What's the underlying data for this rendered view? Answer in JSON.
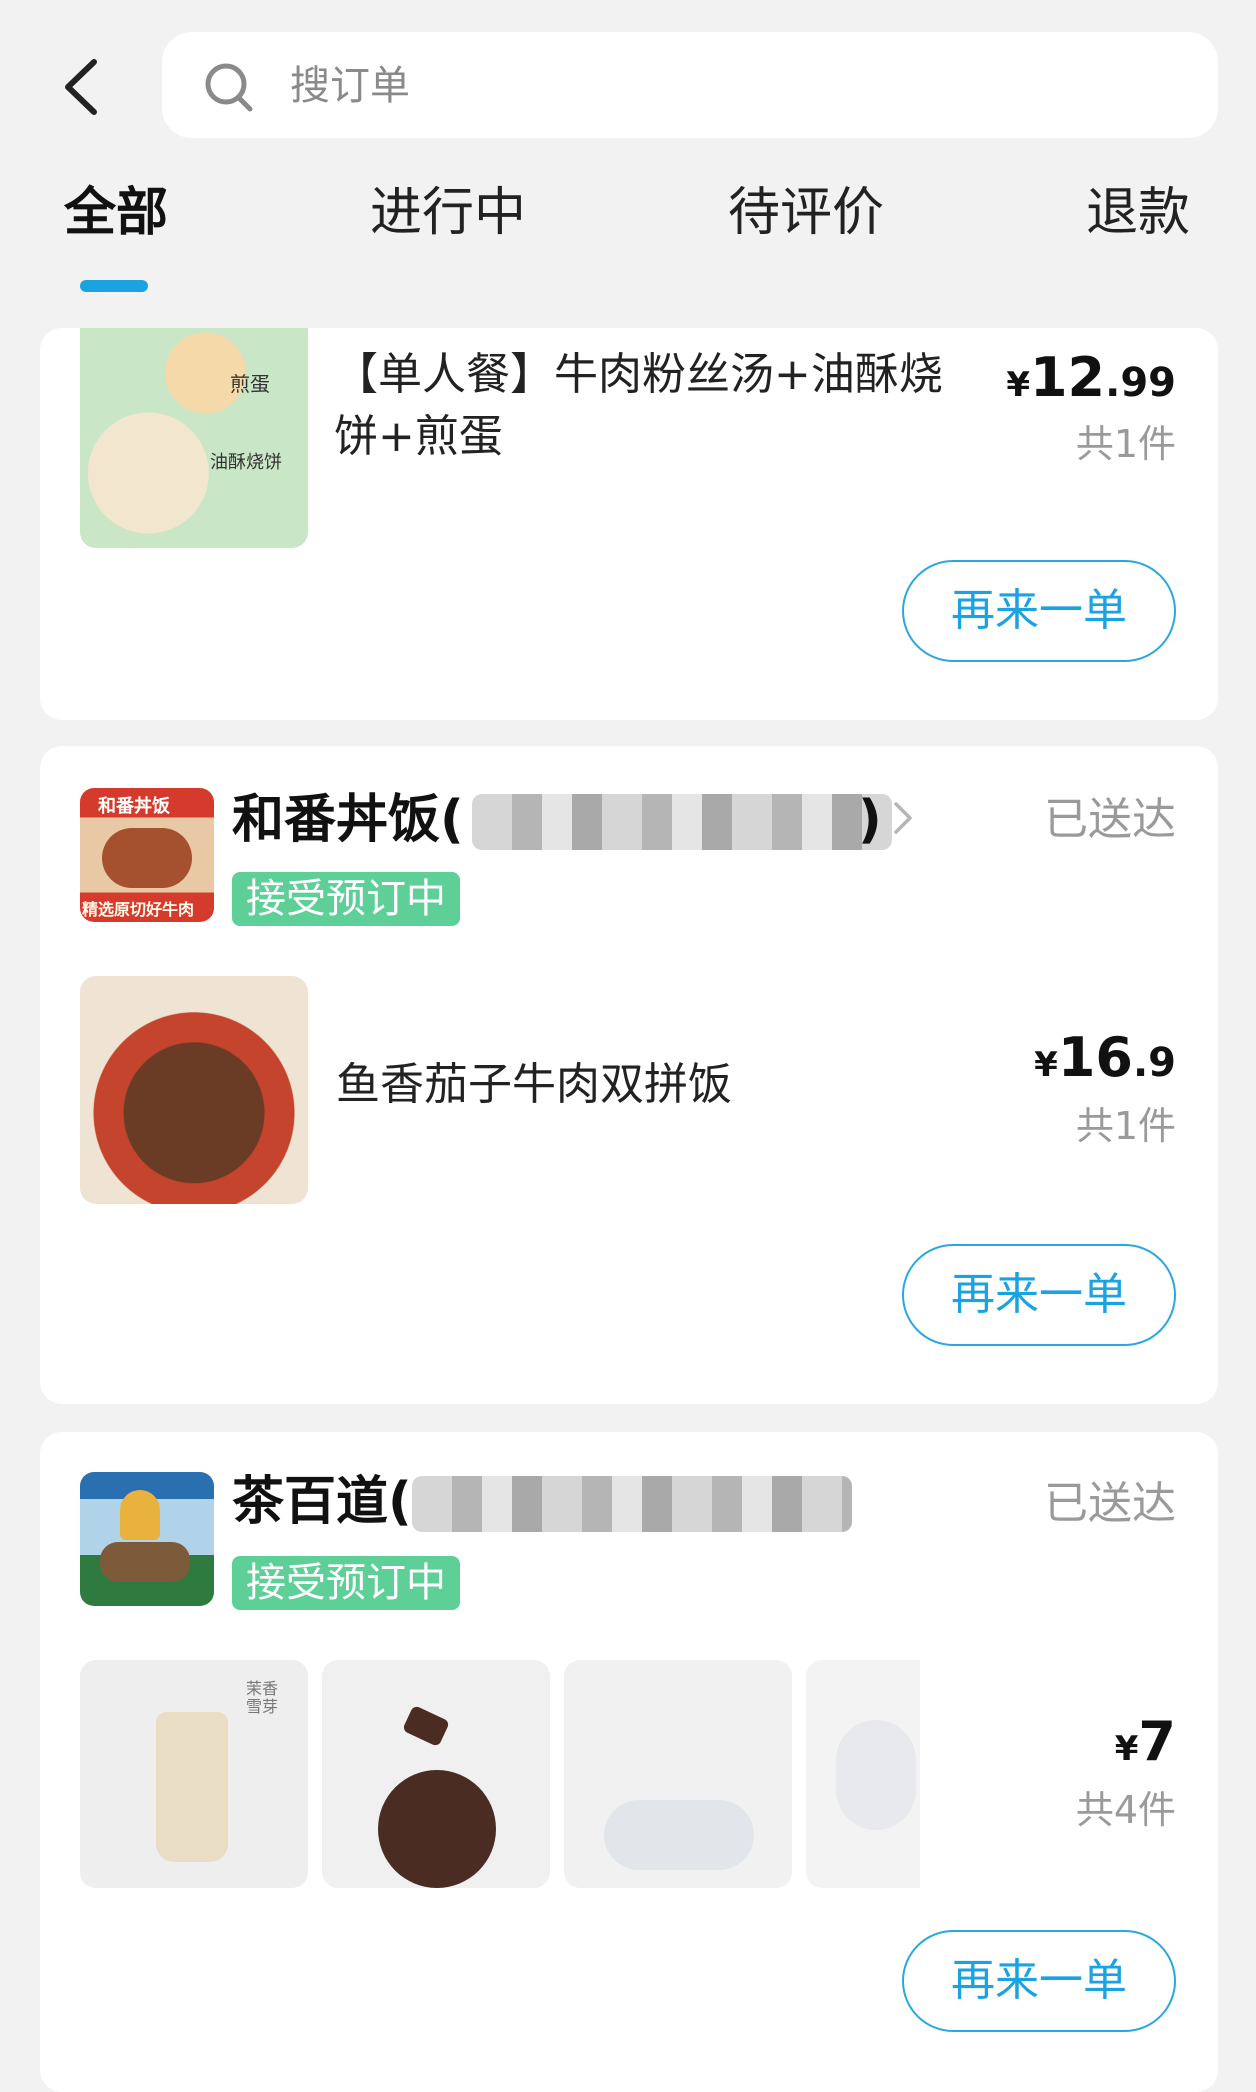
{
  "search": {
    "placeholder": "搜订单"
  },
  "tabs": [
    {
      "label": "全部",
      "active": true
    },
    {
      "label": "进行中"
    },
    {
      "label": "待评价"
    },
    {
      "label": "退款"
    }
  ],
  "colors": {
    "accent": "#1aa3e0",
    "tag": "#5fcf98",
    "status_gray": "#9a9a9a"
  },
  "orders": [
    {
      "items": [
        {
          "name_line1": "【单人餐】牛肉粉丝汤+油酥烧",
          "name_line2": "饼+煎蛋"
        }
      ],
      "price": {
        "symbol": "¥",
        "int": "12",
        "dec": ".99"
      },
      "count": "共1件",
      "reorder": "再来一单",
      "thumb_text": {
        "a": "煎蛋",
        "b": "油酥烧饼"
      }
    },
    {
      "store": {
        "name": "和番丼饭(",
        "name_tail": ")",
        "logo_text_top": "和番丼饭",
        "logo_text_bottom": "精选原切好牛肉"
      },
      "status": "已送达",
      "tag": "接受预订中",
      "items": [
        {
          "name": "鱼香茄子牛肉双拼饭"
        }
      ],
      "price": {
        "symbol": "¥",
        "int": "16",
        "dec": ".9"
      },
      "count": "共1件",
      "reorder": "再来一单"
    },
    {
      "store": {
        "name": "茶百道("
      },
      "status": "已送达",
      "tag": "接受预订中",
      "price": {
        "symbol": "¥",
        "int": "7",
        "dec": ""
      },
      "count": "共4件",
      "reorder": "再来一单",
      "thumb_badge": "茉香雪芽"
    }
  ]
}
